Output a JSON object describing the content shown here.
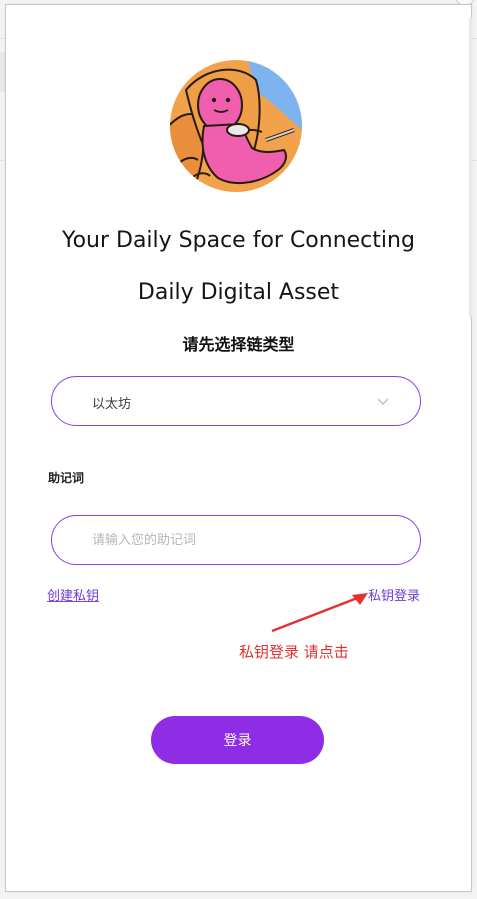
{
  "headline": {
    "line1": "Your Daily Space for Connecting",
    "line2": "Daily Digital Asset"
  },
  "chain_select": {
    "title": "请先选择链类型",
    "selected": "以太坊"
  },
  "mnemonic": {
    "label": "助记词",
    "placeholder": "请输入您的助记词",
    "value": ""
  },
  "links": {
    "create_key": "创建私钥",
    "private_key_login": "私钥登录"
  },
  "annotation": {
    "text": "私钥登录 请点击",
    "color": "#e2322f"
  },
  "login_button": "登录",
  "colors": {
    "accent": "#8e2ce6",
    "border": "#8b3dea",
    "link": "#6f3bd8"
  },
  "icons": {
    "avatar": "cartoon-avatar",
    "dropdown": "chevron-down-icon",
    "annotation_arrow": "arrow-icon"
  }
}
